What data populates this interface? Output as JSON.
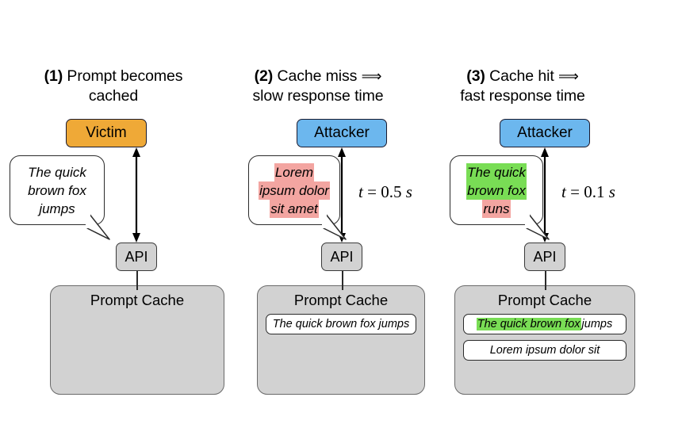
{
  "figure": {
    "type": "diagram",
    "description": "Three-panel diagram illustrating a prompt-cache timing side-channel attack",
    "background_color": "#ffffff"
  },
  "colors": {
    "victim_fill": "#efa937",
    "attacker_fill": "#6cb7ee",
    "cache_fill": "#d2d2d2",
    "api_fill": "#d2d2d2",
    "highlight_green": "#79dd55",
    "highlight_red": "#f3a5a1",
    "stroke": "#1a1a2e",
    "bubble_fill": "#ffffff"
  },
  "panels": [
    {
      "id": "panel-1",
      "title_number": "(1)",
      "title_line1": "Prompt becomes",
      "title_line2": "cached",
      "title_arrow": "",
      "actor": {
        "label": "Victim",
        "fill": "#efa937"
      },
      "bubble": {
        "lines": [
          {
            "text": "The quick",
            "highlight": "none"
          },
          {
            "text": "brown fox",
            "highlight": "none"
          },
          {
            "text": "jumps",
            "highlight": "none"
          }
        ]
      },
      "timing_label": null,
      "api": {
        "label": "API"
      },
      "cache": {
        "title": "Prompt Cache",
        "entries": []
      }
    },
    {
      "id": "panel-2",
      "title_number": "(2)",
      "title_line1": "Cache miss",
      "title_line2": "slow response time",
      "title_arrow": "⟹",
      "actor": {
        "label": "Attacker",
        "fill": "#6cb7ee"
      },
      "bubble": {
        "lines": [
          {
            "text": "Lorem",
            "highlight": "red"
          },
          {
            "text": "ipsum dolor",
            "highlight": "red"
          },
          {
            "text": "sit amet",
            "highlight": "red"
          }
        ]
      },
      "timing_label": {
        "variable": "t",
        "equals": "=",
        "value": "0.5",
        "unit": "s"
      },
      "api": {
        "label": "API"
      },
      "cache": {
        "title": "Prompt Cache",
        "entries": [
          {
            "segments": [
              {
                "text": "The quick brown fox jumps",
                "highlight": "none"
              }
            ]
          }
        ]
      }
    },
    {
      "id": "panel-3",
      "title_number": "(3)",
      "title_line1": "Cache hit",
      "title_line2": "fast response time",
      "title_arrow": "⟹",
      "actor": {
        "label": "Attacker",
        "fill": "#6cb7ee"
      },
      "bubble": {
        "lines": [
          {
            "text": "The quick",
            "highlight": "green"
          },
          {
            "text": "brown fox",
            "highlight": "green"
          },
          {
            "text": "runs",
            "highlight": "red"
          }
        ]
      },
      "timing_label": {
        "variable": "t",
        "equals": "=",
        "value": "0.1",
        "unit": "s"
      },
      "api": {
        "label": "API"
      },
      "cache": {
        "title": "Prompt Cache",
        "entries": [
          {
            "segments": [
              {
                "text": "The quick brown fox",
                "highlight": "green"
              },
              {
                "text": " jumps",
                "highlight": "none"
              }
            ]
          },
          {
            "segments": [
              {
                "text": "Lorem ipsum dolor sit",
                "highlight": "none"
              }
            ]
          }
        ]
      }
    }
  ]
}
